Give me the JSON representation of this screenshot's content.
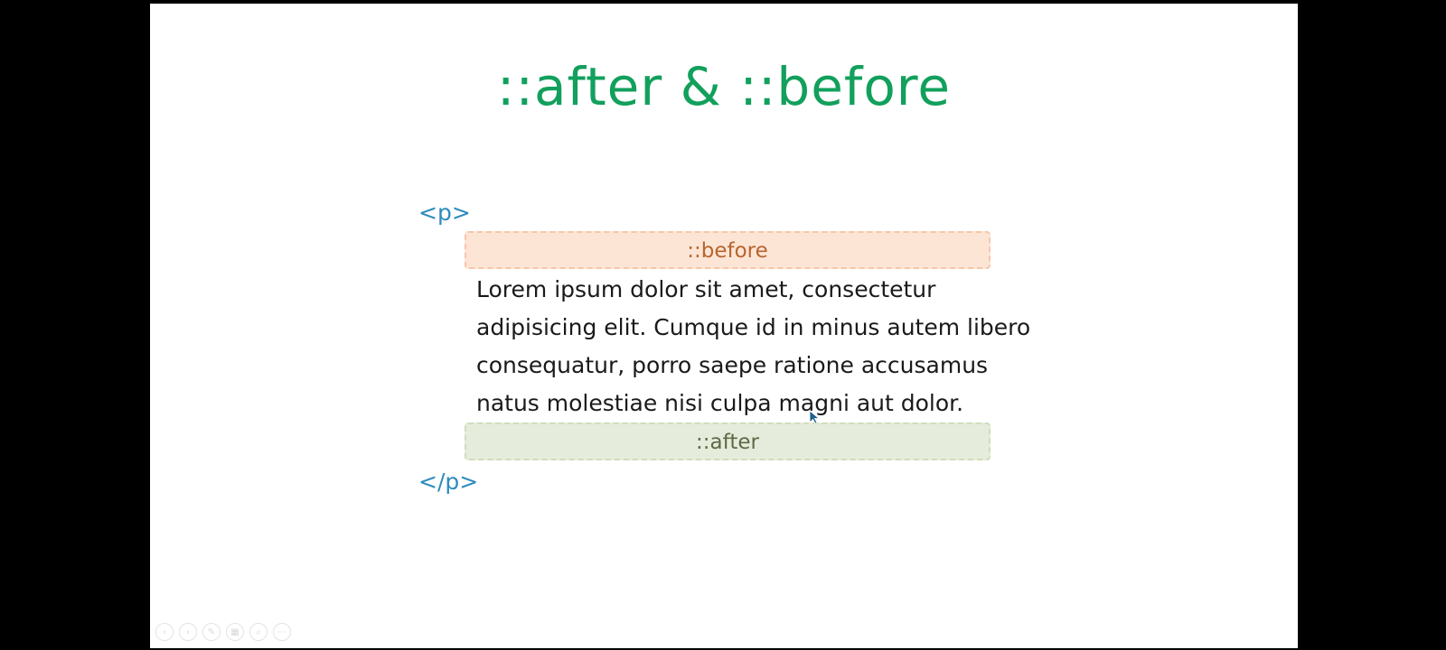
{
  "slide": {
    "title": "::after & ::before",
    "open_tag": "<p>",
    "close_tag": "</p>",
    "before_label": "::before",
    "after_label": "::after",
    "content_lines": [
      "Lorem ipsum dolor sit amet, consectetur",
      "adipisicing elit. Cumque id in minus autem libero",
      "consequatur, porro saepe ratione accusamus",
      "natus molestiae nisi culpa magni aut dolor."
    ]
  },
  "controls": [
    {
      "name": "previous-slide",
      "icon": "chevron-left-icon",
      "glyph": "‹"
    },
    {
      "name": "next-slide",
      "icon": "chevron-right-icon",
      "glyph": "›"
    },
    {
      "name": "pen-tool",
      "icon": "pen-icon",
      "glyph": "✎"
    },
    {
      "name": "slides-grid",
      "icon": "grid-icon",
      "glyph": "▦"
    },
    {
      "name": "zoom",
      "icon": "magnifier-icon",
      "glyph": "⌕"
    },
    {
      "name": "more-options",
      "icon": "more-icon",
      "glyph": "⋯"
    }
  ],
  "colors": {
    "title": "#12a05c",
    "tag": "#2e8bbd",
    "before_fill": "#fde5d6",
    "before_text": "#b5652e",
    "after_fill": "#e6ecdb",
    "after_text": "#5d6a45",
    "cursor": "#1f5f8b"
  }
}
